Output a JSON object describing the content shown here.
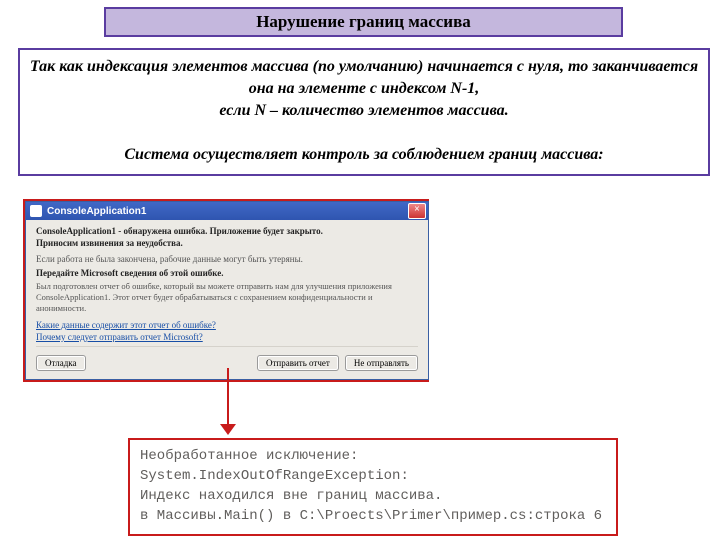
{
  "title": "Нарушение   границ  массива",
  "description": {
    "p1": "Так как индексация элементов массива (по умолчанию) начинается с нуля, то заканчивается она на элементе с индексом N-1,",
    "p2": "если N – количество элементов массива.",
    "p3": "Система осуществляет контроль за соблюдением границ массива:"
  },
  "dialog": {
    "title": "ConsoleApplication1",
    "close": "×",
    "line1": "ConsoleApplication1 - обнаружена ошибка. Приложение будет закрыто.",
    "line2": "Приносим извинения за неудобства.",
    "line3": "Если работа не была закончена, рабочие данные могут быть утеряны.",
    "line4": "Передайте Microsoft сведения об этой ошибке.",
    "line5": "Был подготовлен отчет об ошибке, который вы можете отправить нам для улучшения приложения ConsoleApplication1. Этот отчет будет обрабатываться с сохранением конфиденциальности и анонимности.",
    "link1": "Какие данные содержит этот отчет об ошибке?",
    "link2": "Почему следует отправить отчет Microsoft?",
    "btn_debug": "Отладка",
    "btn_send": "Отправить отчет",
    "btn_dont": "Не отправлять"
  },
  "exception": {
    "l1": "Необработанное исключение:",
    "l2": "System.IndexOutOfRangeException:",
    "l3": "Индекс находился вне границ массива.",
    "l4": "в Массивы.Main() в C:\\Proects\\Primer\\пример.cs:строка 6"
  }
}
